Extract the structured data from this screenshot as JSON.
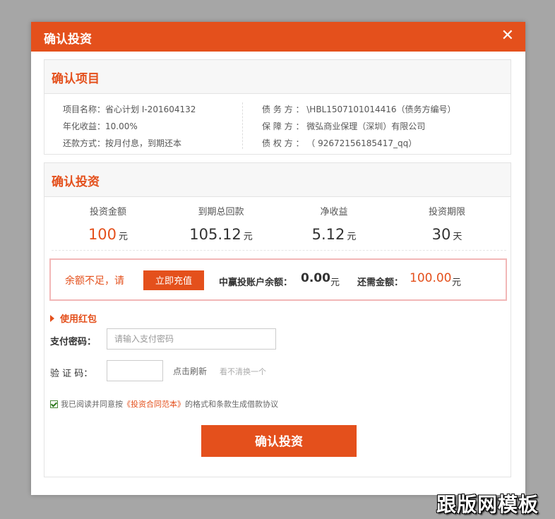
{
  "dialog": {
    "title": "确认投资",
    "close_symbol": "✕"
  },
  "project": {
    "section_title": "确认项目",
    "name": "项目名称：省心计划 I-201604132",
    "annual_yield": "年化收益：10.00%",
    "repayment": "还款方式：按月付息，到期还本",
    "debtor": "债 务 方 ： \\HBL1507101014416（债务方编号）",
    "guarantor": "保 障 方 ： 微弘商业保理（深圳）有限公司",
    "creditor": "债 权 方 ： （ 92672156185417_qq）"
  },
  "investment": {
    "section_title": "确认投资",
    "stats": [
      {
        "label": "投资金额",
        "value": "100",
        "unit": "元"
      },
      {
        "label": "到期总回款",
        "value": "105.12",
        "unit": "元"
      },
      {
        "label": "净收益",
        "value": "5.12",
        "unit": "元"
      },
      {
        "label": "投资期限",
        "value": "30",
        "unit": "天"
      }
    ],
    "warning": {
      "text": "余额不足，请",
      "recharge_button": "立即充值",
      "balance_label": "中赢投账户余额：",
      "balance_value": "0.00",
      "balance_unit": "元",
      "need_label": "还需金额：",
      "need_value": "100.00",
      "need_unit": "元"
    },
    "red_packet": "使用红包",
    "password": {
      "label": "支付密码：",
      "placeholder": "请输入支付密码"
    },
    "captcha": {
      "label": "验 证 码：",
      "refresh": "点击刷新",
      "hint": "看不清换一个"
    },
    "agreement": {
      "prefix": "我已阅读并同意按",
      "link": "《投资合同范本》",
      "suffix": "的格式和条款生成借款协议",
      "checked": true
    },
    "confirm_button": "确认投资"
  },
  "watermark": "跟版网模板",
  "colors": {
    "accent": "#e4501c",
    "overlay": "#a6a6a6",
    "warning_border": "#f2b7b7"
  }
}
